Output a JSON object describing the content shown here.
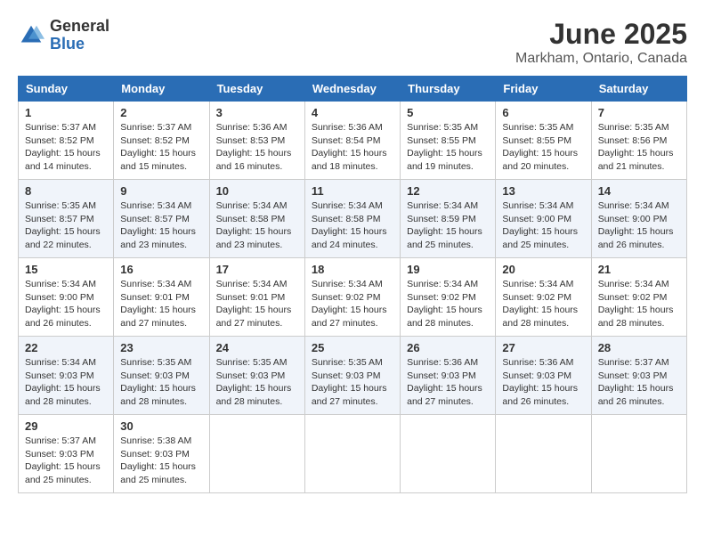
{
  "logo": {
    "general": "General",
    "blue": "Blue"
  },
  "header": {
    "month": "June 2025",
    "location": "Markham, Ontario, Canada"
  },
  "weekdays": [
    "Sunday",
    "Monday",
    "Tuesday",
    "Wednesday",
    "Thursday",
    "Friday",
    "Saturday"
  ],
  "weeks": [
    [
      {
        "day": 1,
        "sunrise": "5:37 AM",
        "sunset": "8:52 PM",
        "daylight": "15 hours and 14 minutes."
      },
      {
        "day": 2,
        "sunrise": "5:37 AM",
        "sunset": "8:52 PM",
        "daylight": "15 hours and 15 minutes."
      },
      {
        "day": 3,
        "sunrise": "5:36 AM",
        "sunset": "8:53 PM",
        "daylight": "15 hours and 16 minutes."
      },
      {
        "day": 4,
        "sunrise": "5:36 AM",
        "sunset": "8:54 PM",
        "daylight": "15 hours and 18 minutes."
      },
      {
        "day": 5,
        "sunrise": "5:35 AM",
        "sunset": "8:55 PM",
        "daylight": "15 hours and 19 minutes."
      },
      {
        "day": 6,
        "sunrise": "5:35 AM",
        "sunset": "8:55 PM",
        "daylight": "15 hours and 20 minutes."
      },
      {
        "day": 7,
        "sunrise": "5:35 AM",
        "sunset": "8:56 PM",
        "daylight": "15 hours and 21 minutes."
      }
    ],
    [
      {
        "day": 8,
        "sunrise": "5:35 AM",
        "sunset": "8:57 PM",
        "daylight": "15 hours and 22 minutes."
      },
      {
        "day": 9,
        "sunrise": "5:34 AM",
        "sunset": "8:57 PM",
        "daylight": "15 hours and 23 minutes."
      },
      {
        "day": 10,
        "sunrise": "5:34 AM",
        "sunset": "8:58 PM",
        "daylight": "15 hours and 23 minutes."
      },
      {
        "day": 11,
        "sunrise": "5:34 AM",
        "sunset": "8:58 PM",
        "daylight": "15 hours and 24 minutes."
      },
      {
        "day": 12,
        "sunrise": "5:34 AM",
        "sunset": "8:59 PM",
        "daylight": "15 hours and 25 minutes."
      },
      {
        "day": 13,
        "sunrise": "5:34 AM",
        "sunset": "9:00 PM",
        "daylight": "15 hours and 25 minutes."
      },
      {
        "day": 14,
        "sunrise": "5:34 AM",
        "sunset": "9:00 PM",
        "daylight": "15 hours and 26 minutes."
      }
    ],
    [
      {
        "day": 15,
        "sunrise": "5:34 AM",
        "sunset": "9:00 PM",
        "daylight": "15 hours and 26 minutes."
      },
      {
        "day": 16,
        "sunrise": "5:34 AM",
        "sunset": "9:01 PM",
        "daylight": "15 hours and 27 minutes."
      },
      {
        "day": 17,
        "sunrise": "5:34 AM",
        "sunset": "9:01 PM",
        "daylight": "15 hours and 27 minutes."
      },
      {
        "day": 18,
        "sunrise": "5:34 AM",
        "sunset": "9:02 PM",
        "daylight": "15 hours and 27 minutes."
      },
      {
        "day": 19,
        "sunrise": "5:34 AM",
        "sunset": "9:02 PM",
        "daylight": "15 hours and 28 minutes."
      },
      {
        "day": 20,
        "sunrise": "5:34 AM",
        "sunset": "9:02 PM",
        "daylight": "15 hours and 28 minutes."
      },
      {
        "day": 21,
        "sunrise": "5:34 AM",
        "sunset": "9:02 PM",
        "daylight": "15 hours and 28 minutes."
      }
    ],
    [
      {
        "day": 22,
        "sunrise": "5:34 AM",
        "sunset": "9:03 PM",
        "daylight": "15 hours and 28 minutes."
      },
      {
        "day": 23,
        "sunrise": "5:35 AM",
        "sunset": "9:03 PM",
        "daylight": "15 hours and 28 minutes."
      },
      {
        "day": 24,
        "sunrise": "5:35 AM",
        "sunset": "9:03 PM",
        "daylight": "15 hours and 28 minutes."
      },
      {
        "day": 25,
        "sunrise": "5:35 AM",
        "sunset": "9:03 PM",
        "daylight": "15 hours and 27 minutes."
      },
      {
        "day": 26,
        "sunrise": "5:36 AM",
        "sunset": "9:03 PM",
        "daylight": "15 hours and 27 minutes."
      },
      {
        "day": 27,
        "sunrise": "5:36 AM",
        "sunset": "9:03 PM",
        "daylight": "15 hours and 26 minutes."
      },
      {
        "day": 28,
        "sunrise": "5:37 AM",
        "sunset": "9:03 PM",
        "daylight": "15 hours and 26 minutes."
      }
    ],
    [
      {
        "day": 29,
        "sunrise": "5:37 AM",
        "sunset": "9:03 PM",
        "daylight": "15 hours and 25 minutes."
      },
      {
        "day": 30,
        "sunrise": "5:38 AM",
        "sunset": "9:03 PM",
        "daylight": "15 hours and 25 minutes."
      },
      null,
      null,
      null,
      null,
      null
    ]
  ]
}
